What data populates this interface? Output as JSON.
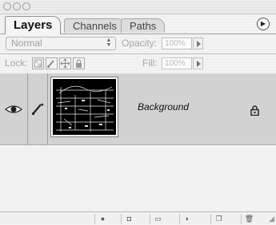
{
  "tabs": [
    {
      "label": "Layers",
      "active": true
    },
    {
      "label": "Channels",
      "active": false
    },
    {
      "label": "Paths",
      "active": false
    }
  ],
  "blend_mode": {
    "value": "Normal"
  },
  "opacity": {
    "label": "Opacity:",
    "value": "100%"
  },
  "lock": {
    "label": "Lock:",
    "icons": [
      "transparency-lock-icon",
      "brush-lock-icon",
      "move-lock-icon",
      "padlock-icon"
    ]
  },
  "fill": {
    "label": "Fill:",
    "value": "100%"
  },
  "layers": [
    {
      "name": "Background",
      "visible": true,
      "locked": true
    }
  ],
  "bottom_buttons": [
    "layer-style-icon",
    "layer-mask-icon",
    "new-group-icon",
    "adjustment-layer-icon",
    "new-layer-icon",
    "trash-icon"
  ],
  "colors": {
    "layer_row": "#d2d2d2",
    "thumbnail": "#000000"
  }
}
